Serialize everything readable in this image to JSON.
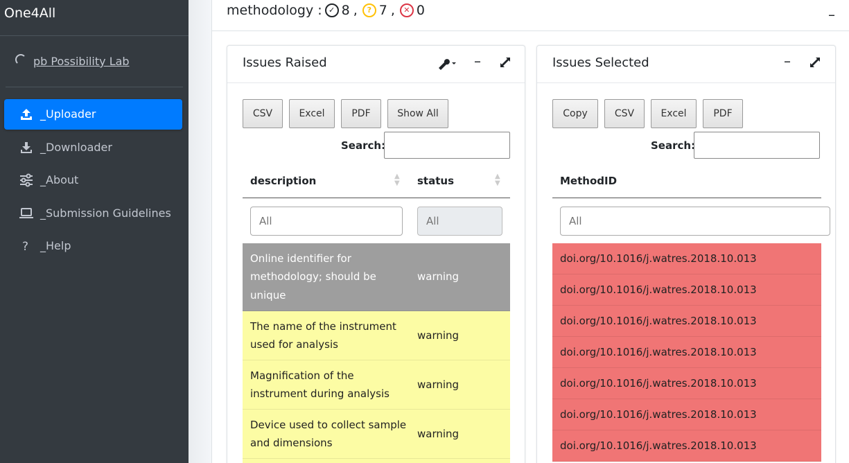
{
  "app": {
    "title": "One4All"
  },
  "user": {
    "name": "pb Possibility Lab"
  },
  "nav": [
    {
      "label": "Uploader",
      "icon": "upload-icon",
      "active": true
    },
    {
      "label": "Downloader",
      "icon": "download-icon",
      "active": false
    },
    {
      "label": "About",
      "icon": "sliders-icon",
      "active": false
    },
    {
      "label": "Submission Guidelines",
      "icon": "laptop-icon",
      "active": false
    },
    {
      "label": "Help",
      "icon": "question-icon",
      "active": false
    }
  ],
  "section": {
    "title": "methodology",
    "separator": ":",
    "ok_count": "8",
    "warn_count": "7",
    "error_count": "0",
    "comma": ","
  },
  "issues_raised": {
    "title": "Issues Raised",
    "buttons": [
      "CSV",
      "Excel",
      "PDF",
      "Show All"
    ],
    "search_label": "Search:",
    "columns": [
      "description",
      "status"
    ],
    "filter_placeholder": "All",
    "rows": [
      {
        "description": "Online identifier for methodology; should be unique",
        "status": "warning",
        "color": "grey"
      },
      {
        "description": "The name of the instrument used for analysis",
        "status": "warning",
        "color": "yellow"
      },
      {
        "description": "Magnification of the instrument during analysis",
        "status": "warning",
        "color": "yellow"
      },
      {
        "description": "Device used to collect sample and dimensions",
        "status": "warning",
        "color": "yellow"
      }
    ]
  },
  "issues_selected": {
    "title": "Issues Selected",
    "buttons": [
      "Copy",
      "CSV",
      "Excel",
      "PDF"
    ],
    "search_label": "Search:",
    "columns": [
      "MethodID"
    ],
    "filter_placeholder": "All",
    "rows": [
      "doi.org/10.1016/j.watres.2018.10.013",
      "doi.org/10.1016/j.watres.2018.10.013",
      "doi.org/10.1016/j.watres.2018.10.013",
      "doi.org/10.1016/j.watres.2018.10.013",
      "doi.org/10.1016/j.watres.2018.10.013",
      "doi.org/10.1016/j.watres.2018.10.013",
      "doi.org/10.1016/j.watres.2018.10.013"
    ]
  },
  "colors": {
    "sidebar_bg": "#343a40",
    "active_nav": "#007bff",
    "row_grey": "#9e9e9e",
    "row_yellow": "#fcfca4",
    "row_red": "#f07575"
  }
}
